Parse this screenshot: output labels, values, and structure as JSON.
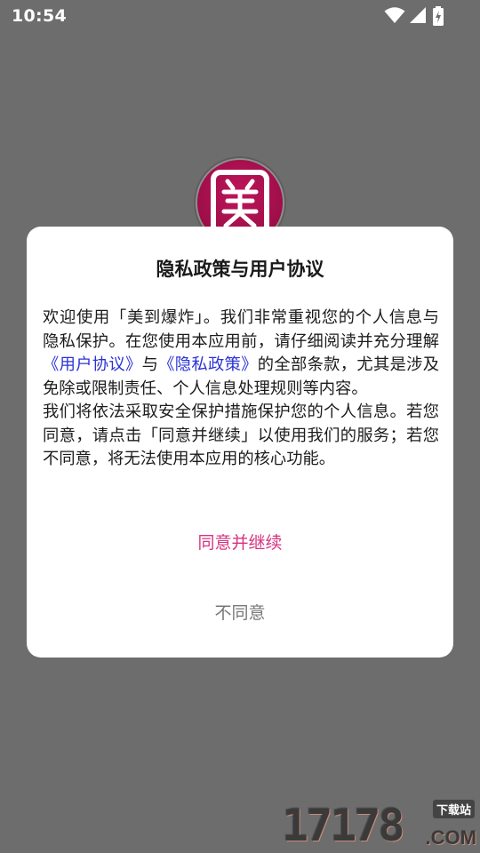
{
  "status_bar": {
    "time": "10:54",
    "icons": [
      "wifi-icon",
      "cellular-signal-icon",
      "battery-charging-icon"
    ]
  },
  "app_logo": {
    "glyph": "美"
  },
  "dialog": {
    "title": "隐私政策与用户协议",
    "body": {
      "intro": "欢迎使用「美到爆炸」。我们非常重视您的个人信息与隐私保护。在您使用本应用前，请仔细阅读并充分理解",
      "user_agreement_link": "《用户协议》",
      "and": "与",
      "privacy_policy_link": "《隐私政策》",
      "intro_end": "的全部条款，尤其是涉及免除或限制责任、个人信息处理规则等内容。",
      "paragraph2": "我们将依法采取安全保护措施保护您的个人信息。若您同意，请点击「同意并继续」以使用我们的服务；若您不同意，将无法使用本应用的核心功能。"
    },
    "agree_label": "同意并继续",
    "disagree_label": "不同意"
  },
  "watermark": {
    "digits": "17178",
    "tag": "下载站",
    "suffix": ".COM"
  },
  "colors": {
    "overlay": "#6d6d6d",
    "link": "#2b33d6",
    "accent": "#d63580",
    "secondary": "#777777"
  }
}
